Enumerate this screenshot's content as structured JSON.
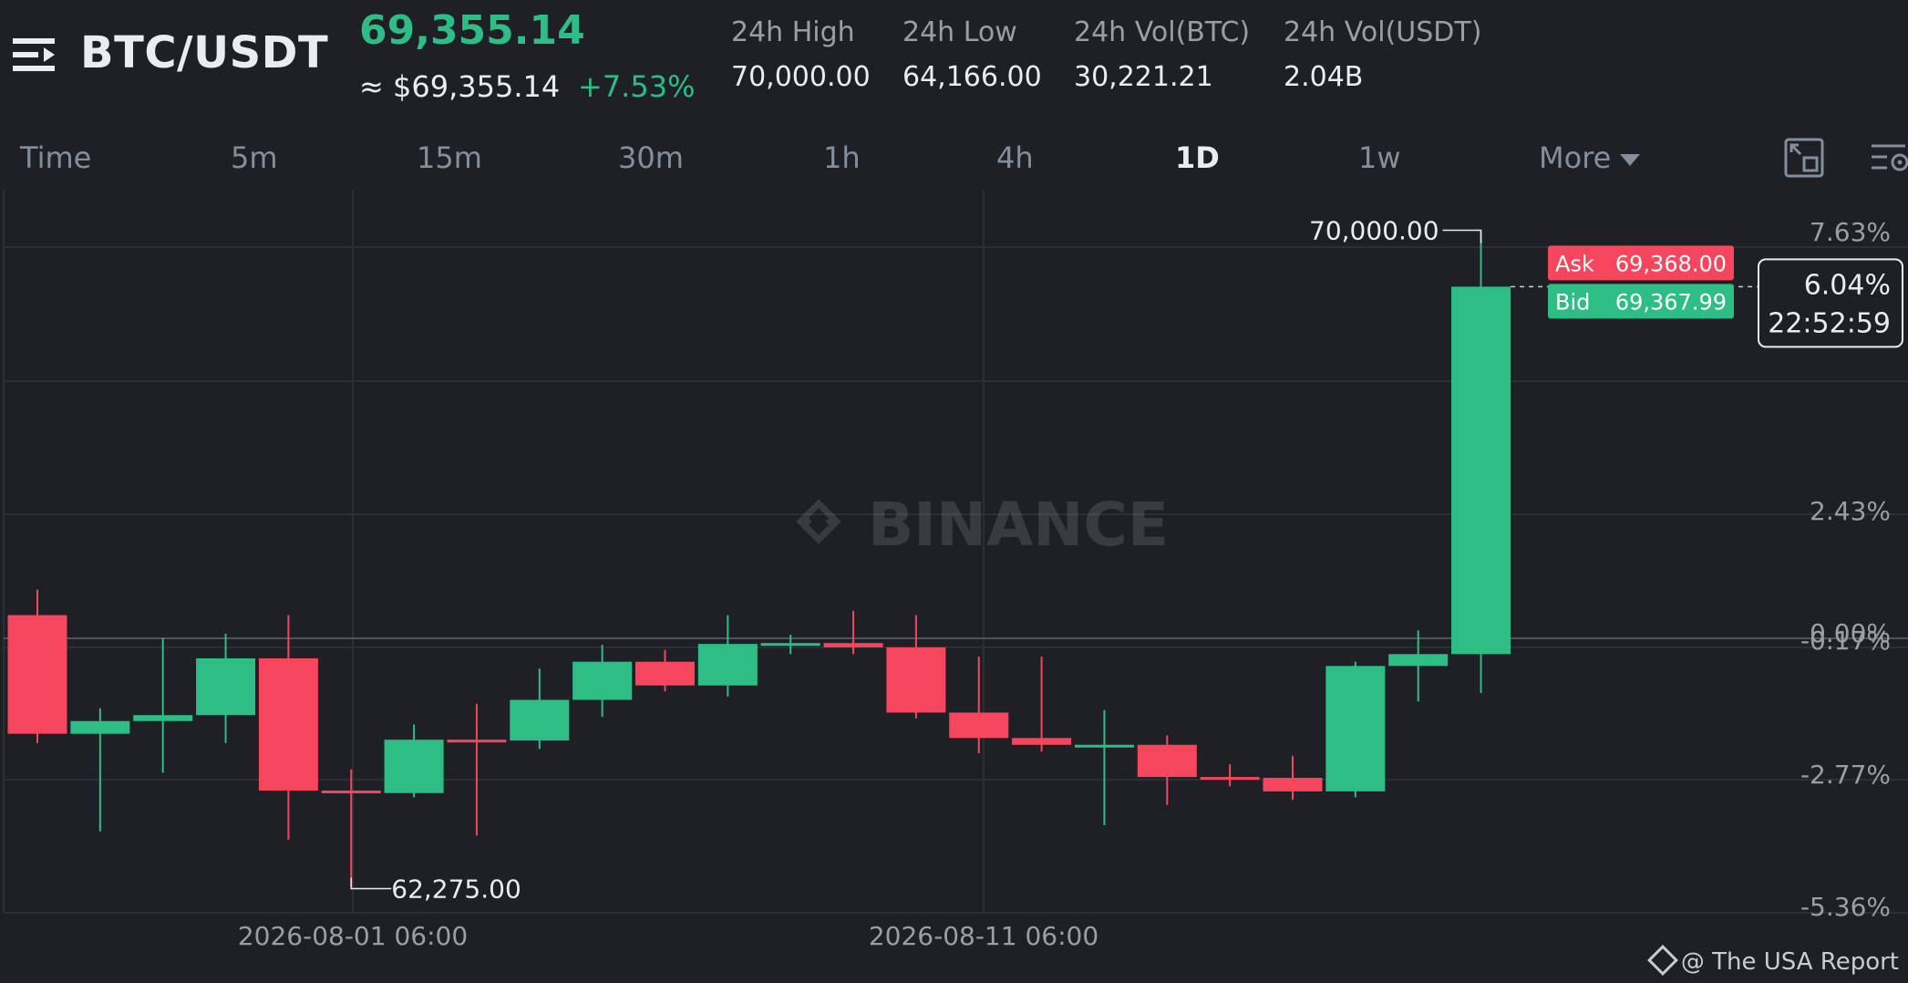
{
  "header": {
    "pair": "BTC/USDT",
    "price": "69,355.14",
    "approx": "≈ $69,355.14",
    "change": "+7.53%",
    "stats": [
      {
        "label": "24h High",
        "value": "70,000.00"
      },
      {
        "label": "24h Low",
        "value": "64,166.00"
      },
      {
        "label": "24h Vol(BTC)",
        "value": "30,221.21"
      },
      {
        "label": "24h Vol(USDT)",
        "value": "2.04B"
      }
    ]
  },
  "tabs": [
    "Time",
    "5m",
    "15m",
    "30m",
    "1h",
    "4h",
    "1D",
    "1w",
    "More"
  ],
  "active_tab": "1D",
  "icons": {
    "menu": "menu-icon",
    "fullscreen": "fullscreen-icon",
    "settings": "chart-settings-icon",
    "more_caret": "caret-down-icon"
  },
  "colors": {
    "up": "#2ebd85",
    "down": "#f6465d",
    "background": "#1e2026"
  },
  "chart_data": {
    "type": "candlestick",
    "x_labels": [
      "2026-08-01 06:00",
      "2026-08-11 06:00"
    ],
    "y_axis_percent_labels": [
      "7.63%",
      "6.04%",
      "2.43%",
      "0.00%",
      "-0.17%",
      "-2.77%",
      "-5.36%"
    ],
    "candles": [
      {
        "open": 65480,
        "high": 65780,
        "low": 63970,
        "close": 64080
      },
      {
        "open": 64080,
        "high": 64380,
        "low": 62930,
        "close": 64230
      },
      {
        "open": 64230,
        "high": 65210,
        "low": 63620,
        "close": 64300
      },
      {
        "open": 64300,
        "high": 65260,
        "low": 63970,
        "close": 64970
      },
      {
        "open": 64970,
        "high": 65480,
        "low": 62830,
        "close": 63410
      },
      {
        "open": 63410,
        "high": 63660,
        "low": 62275,
        "close": 63380
      },
      {
        "open": 63380,
        "high": 64190,
        "low": 63330,
        "close": 64010
      },
      {
        "open": 64010,
        "high": 64430,
        "low": 62880,
        "close": 64000
      },
      {
        "open": 64000,
        "high": 64850,
        "low": 63900,
        "close": 64480
      },
      {
        "open": 64480,
        "high": 65130,
        "low": 64280,
        "close": 64930
      },
      {
        "open": 64930,
        "high": 65070,
        "low": 64580,
        "close": 64650
      },
      {
        "open": 64650,
        "high": 65480,
        "low": 64520,
        "close": 65140
      },
      {
        "open": 65140,
        "high": 65250,
        "low": 65020,
        "close": 65150
      },
      {
        "open": 65150,
        "high": 65530,
        "low": 65020,
        "close": 65100
      },
      {
        "open": 65100,
        "high": 65480,
        "low": 64260,
        "close": 64330
      },
      {
        "open": 64330,
        "high": 64990,
        "low": 63850,
        "close": 64030
      },
      {
        "open": 64030,
        "high": 64990,
        "low": 63870,
        "close": 63950
      },
      {
        "open": 63950,
        "high": 64360,
        "low": 63000,
        "close": 63950
      },
      {
        "open": 63950,
        "high": 64060,
        "low": 63240,
        "close": 63570
      },
      {
        "open": 63570,
        "high": 63720,
        "low": 63460,
        "close": 63560
      },
      {
        "open": 63560,
        "high": 63820,
        "low": 63300,
        "close": 63400
      },
      {
        "open": 63400,
        "high": 64930,
        "low": 63330,
        "close": 64880
      },
      {
        "open": 64880,
        "high": 65300,
        "low": 64460,
        "close": 65020
      },
      {
        "open": 65020,
        "high": 70000,
        "low": 64560,
        "close": 69355.14
      }
    ],
    "ylim": [
      62000,
      70500
    ],
    "high_marker": "70,000.00",
    "low_marker": "62,275.00",
    "ask": {
      "label": "Ask",
      "value": "69,368.00"
    },
    "bid": {
      "label": "Bid",
      "value": "69,367.99"
    },
    "current_change": "6.04%",
    "countdown": "22:52:59",
    "watermark": "BINANCE"
  },
  "credit": "@ The USA Report"
}
